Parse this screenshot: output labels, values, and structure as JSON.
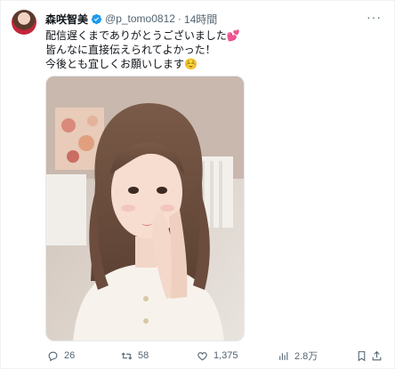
{
  "tweet": {
    "display_name": "森咲智美",
    "handle": "@p_tomo0812",
    "separator": "·",
    "time": "14時間",
    "lines": [
      "配信遅くまでありがとうございました💕",
      "皆んなに直接伝えられてよかった！",
      "今後とも宜しくお願いします☺️"
    ]
  },
  "actions": {
    "reply_count": "26",
    "retweet_count": "58",
    "like_count": "1,375",
    "views_count": "2.8万"
  },
  "icons": {
    "verified": "verified-badge-icon",
    "reply": "comment-icon",
    "retweet": "retweet-icon",
    "like": "heart-icon",
    "views": "bar-chart-icon",
    "bookmark": "bookmark-icon",
    "share": "share-icon"
  },
  "colors": {
    "verified": "#1d9bf0",
    "text": "#0f1419",
    "muted": "#536471"
  }
}
